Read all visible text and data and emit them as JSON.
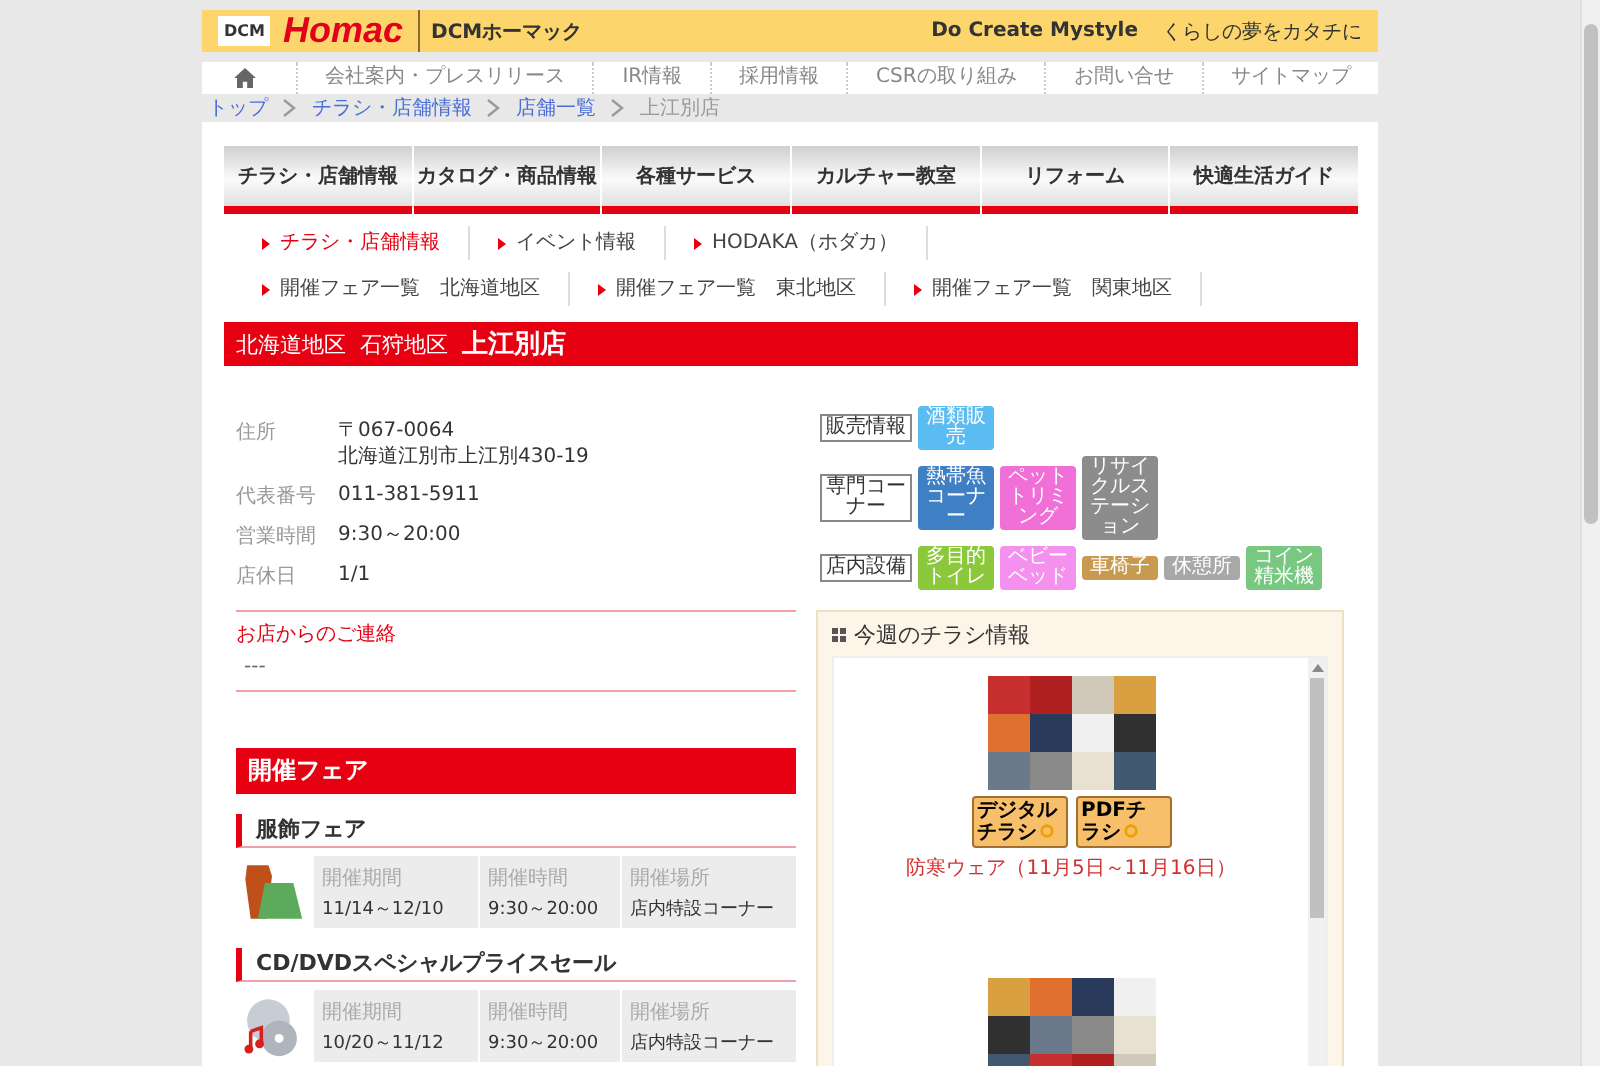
{
  "header": {
    "logo_small": "DCM",
    "logo": "Homac",
    "logo_sub": "DCMホーマック",
    "slogan": "Do Create Mystyle",
    "tagline": "くらしの夢をカタチに"
  },
  "top_nav": [
    "会社案内・プレスリリース",
    "IR情報",
    "採用情報",
    "CSRの取り組み",
    "お問い合せ",
    "サイトマップ"
  ],
  "breadcrumb": [
    {
      "label": "トップ",
      "link": true
    },
    {
      "label": "チラシ・店舗情報",
      "link": true
    },
    {
      "label": "店舗一覧",
      "link": true
    },
    {
      "label": "上江別店",
      "link": false
    }
  ],
  "main_tabs": [
    "チラシ・店舗情報",
    "カタログ・商品情報",
    "各種サービス",
    "カルチャー教室",
    "リフォーム",
    "快適生活ガイド"
  ],
  "sub_nav": [
    [
      {
        "label": "チラシ・店舗情報",
        "selected": true
      },
      {
        "label": "イベント情報",
        "selected": false
      },
      {
        "label": "HODAKA（ホダカ）",
        "selected": false
      }
    ],
    [
      {
        "label": "開催フェア一覧　北海道地区",
        "selected": false
      },
      {
        "label": "開催フェア一覧　東北地区",
        "selected": false
      },
      {
        "label": "開催フェア一覧　関東地区",
        "selected": false
      }
    ]
  ],
  "title_bar": {
    "areas": [
      "北海道地区",
      "石狩地区"
    ],
    "store": "上江別店"
  },
  "store_info": [
    {
      "label": "住所",
      "lines": [
        "〒067-0064",
        "北海道江別市上江別430-19"
      ]
    },
    {
      "label": "代表番号",
      "lines": [
        "011-381-5911"
      ]
    },
    {
      "label": "営業時間",
      "lines": [
        "9:30～20:00"
      ]
    },
    {
      "label": "店休日",
      "lines": [
        "1/1"
      ]
    }
  ],
  "notice": {
    "title": "お店からのご連絡",
    "text": "---"
  },
  "services": [
    {
      "label": "販売情報",
      "chips": [
        {
          "text": "酒類販売",
          "color": "#5bbcf2"
        }
      ]
    },
    {
      "label": "専門コーナー",
      "chips": [
        {
          "text": "熱帯魚コーナー",
          "color": "#3f7fc4"
        },
        {
          "text": "ペットトリミング",
          "color": "#f070d8"
        },
        {
          "text": "リサイクルステーション",
          "color": "#8c8c8c"
        }
      ]
    },
    {
      "label": "店内設備",
      "chips": [
        {
          "text": "多目的トイレ",
          "color": "#8cc83c"
        },
        {
          "text": "ベビーベッド",
          "color": "#f490ee"
        },
        {
          "text": "車椅子",
          "color": "#c89a50"
        },
        {
          "text": "休憩所",
          "color": "#a8a8a8"
        },
        {
          "text": "コイン精米機",
          "color": "#78c882"
        }
      ]
    }
  ],
  "flyers": {
    "title": "今週のチラシ情報",
    "items": [
      {
        "kind": "flyer",
        "buttons": [
          "デジタルチラシ",
          "PDFチラシ"
        ],
        "caption": "防寒ウェア（11月5日～11月16日）"
      },
      {
        "kind": "picture"
      }
    ]
  },
  "fairs": {
    "title": "開催フェア",
    "items": [
      {
        "name": "服飾フェア",
        "kind": "clothing",
        "fields": [
          {
            "label": "開催期間",
            "value": "11/14～12/10"
          },
          {
            "label": "開催時間",
            "value": "9:30～20:00"
          },
          {
            "label": "開催場所",
            "value": "店内特設コーナー"
          }
        ]
      },
      {
        "name": "CD/DVDスペシャルプライスセール",
        "kind": "cd",
        "fields": [
          {
            "label": "開催期間",
            "value": "10/20～11/12"
          },
          {
            "label": "開催時間",
            "value": "9:30～20:00"
          },
          {
            "label": "開催場所",
            "value": "店内特設コーナー"
          }
        ]
      }
    ]
  }
}
